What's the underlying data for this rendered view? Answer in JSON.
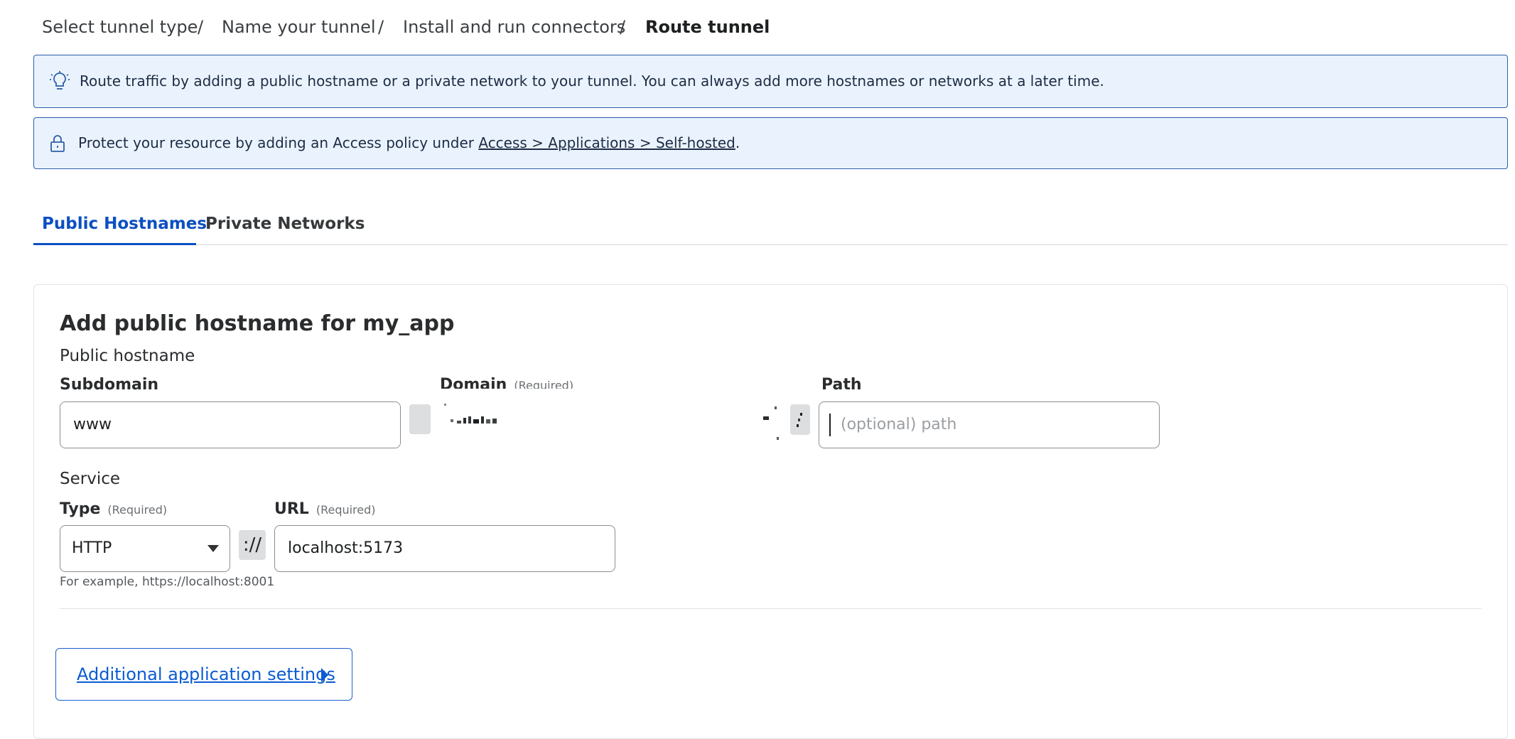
{
  "breadcrumb": {
    "items": [
      "Select tunnel type",
      "Name your tunnel",
      "Install and run connectors",
      "Route tunnel"
    ],
    "separator": "/"
  },
  "banners": {
    "route": {
      "icon": "lightbulb-icon",
      "text": "Route traffic by adding a public hostname or a private network to your tunnel. You can always add more hostnames or networks at a later time."
    },
    "protect": {
      "icon": "lock-icon",
      "text_before": "Protect your resource by adding an Access policy under ",
      "link": "Access > Applications > Self-hosted",
      "text_after": "."
    }
  },
  "tabs": [
    {
      "label": "Public Hostnames",
      "active": true
    },
    {
      "label": "Private Networks",
      "active": false
    }
  ],
  "form": {
    "title": "Add public hostname for my_app",
    "public_hostname_label": "Public hostname",
    "subdomain": {
      "label": "Subdomain",
      "value": "www"
    },
    "domain": {
      "label": "Domain",
      "required": "(Required)"
    },
    "path": {
      "label": "Path",
      "placeholder": "(optional) path"
    },
    "service_label": "Service",
    "type": {
      "label": "Type",
      "required": "(Required)",
      "value": "HTTP"
    },
    "scheme_separator": "://",
    "url": {
      "label": "URL",
      "required": "(Required)",
      "value": "localhost:5173"
    },
    "hint": "For example, https://localhost:8001",
    "additional_settings": "Additional application settings"
  },
  "colors": {
    "accent": "#0b4fc2",
    "banner_bg": "#eaf3fd",
    "banner_border": "#2c5ea8"
  }
}
